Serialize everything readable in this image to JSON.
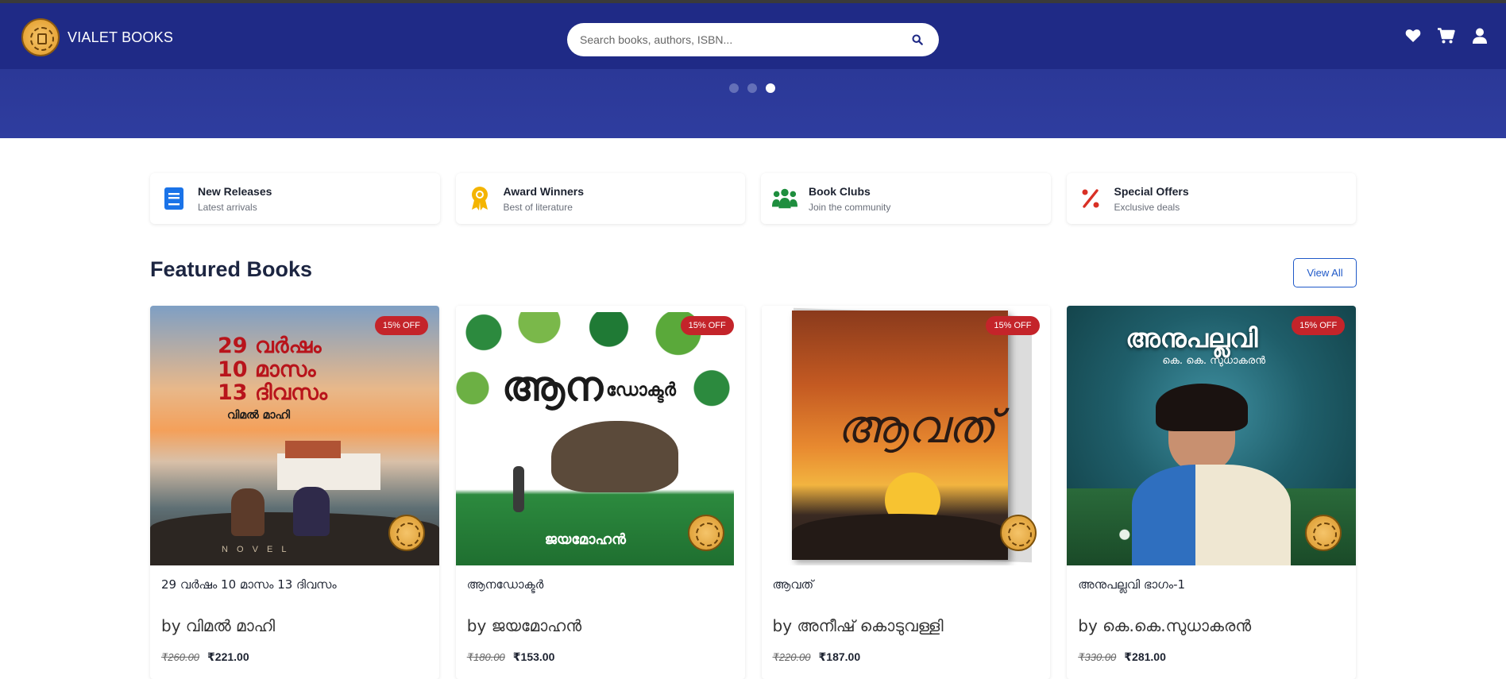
{
  "header": {
    "brand": "VIALET BOOKS",
    "search_placeholder": "Search books, authors, ISBN..."
  },
  "carousel": {
    "slides": 3,
    "active_index": 2
  },
  "features": [
    {
      "title": "New Releases",
      "subtitle": "Latest arrivals",
      "icon": "book-icon",
      "color": "#1a73e8"
    },
    {
      "title": "Award Winners",
      "subtitle": "Best of literature",
      "icon": "award-icon",
      "color": "#f4b400"
    },
    {
      "title": "Book Clubs",
      "subtitle": "Join the community",
      "icon": "users-icon",
      "color": "#1e8e3e"
    },
    {
      "title": "Special Offers",
      "subtitle": "Exclusive deals",
      "icon": "percent-icon",
      "color": "#d93025"
    }
  ],
  "featured": {
    "title": "Featured Books",
    "view_all": "View All"
  },
  "books": [
    {
      "title": "29 വർഷം 10 മാസം 13 ദിവസം",
      "author": "by വിമൽ മാഹി",
      "old_price": "₹260.00",
      "new_price": "₹221.00",
      "badge": "15% OFF",
      "cover_lines": [
        "29 വർഷം",
        "10 മാസം",
        "13 ദിവസം"
      ],
      "cover_author": "വിമൽ മാഹി",
      "cover_footer": "N O V E L"
    },
    {
      "title": "ആനഡോക്ടർ",
      "author": "by ജയമോഹൻ",
      "old_price": "₹180.00",
      "new_price": "₹153.00",
      "badge": "15% OFF",
      "cover_lines": [
        "ആന",
        "ഡോക്ടർ"
      ],
      "cover_author": "ജയമോഹൻ"
    },
    {
      "title": "ആവത്",
      "author": "by അനീഷ് കൊടുവള്ളി",
      "old_price": "₹220.00",
      "new_price": "₹187.00",
      "badge": "15% OFF",
      "cover_lines": [
        "ആവത്"
      ]
    },
    {
      "title": "അനുപല്ലവി ഭാഗം-1",
      "author": "by കെ.കെ.സുധാകരൻ",
      "old_price": "₹330.00",
      "new_price": "₹281.00",
      "badge": "15% OFF",
      "cover_lines": [
        "അനുപല്ലവി"
      ],
      "cover_author": "കെ. കെ. സുധാകരൻ"
    }
  ]
}
